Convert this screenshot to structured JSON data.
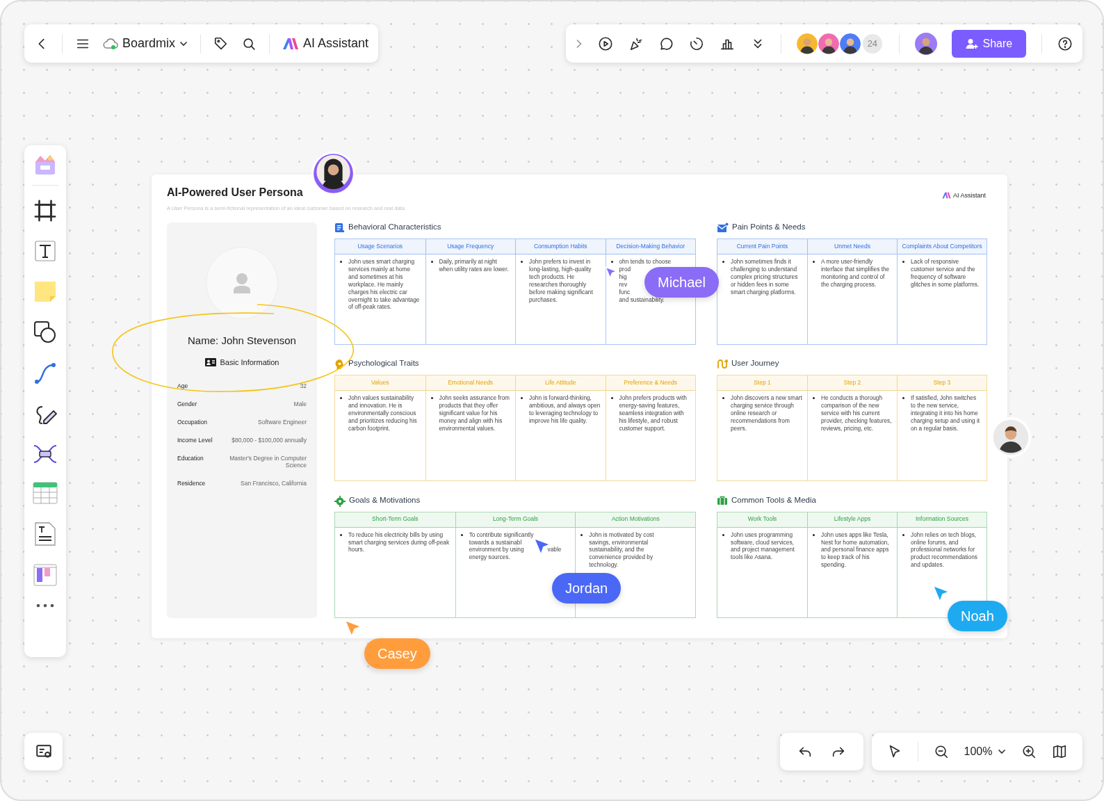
{
  "top_bar": {
    "file_name": "Boardmix",
    "ai_button": "AI Assistant",
    "collaborator_count": "24",
    "share_button": "Share"
  },
  "board": {
    "title": "AI-Powered User Persona",
    "subtitle": "A User Persona is a semi-fictional representation of an ideal customer based on research and real data.",
    "brand": "AI Assistant",
    "profile": {
      "name": "Name: John Stevenson",
      "section_title": "Basic Information",
      "fields": [
        {
          "label": "Age",
          "value": "32"
        },
        {
          "label": "Gender",
          "value": "Male"
        },
        {
          "label": "Occupation",
          "value": "Software Engineer"
        },
        {
          "label": "Income Level",
          "value": "$80,000 - $100,000 annually"
        },
        {
          "label": "Education",
          "value": "Master's Degree in Computer Science"
        },
        {
          "label": "Residence",
          "value": "San Francisco, California"
        }
      ]
    },
    "sections": [
      {
        "kind": "document",
        "title": "Behavioral Characteristics",
        "color": "#2f6fe4",
        "columns": [
          {
            "header": "Usage Scenarios",
            "text": "John uses smart charging services mainly at home and sometimes at his workplace. He mainly charges his electric car overnight to take advantage of off-peak rates."
          },
          {
            "header": "Usage Frequency",
            "text": "Daily, primarily at night when utility rates are lower."
          },
          {
            "header": "Consumption Habits",
            "text": "John prefers to invest in long-lasting, high-quality tech products. He researches thoroughly before making significant purchases."
          },
          {
            "header": "Decision-Making Behavior",
            "lines": [
              [
                "ohn tends to choose"
              ],
              [
                "prod"
              ],
              [
                "hig"
              ],
              [
                "rev"
              ],
              [
                "func"
              ],
              [
                "and sustainability."
              ]
            ]
          }
        ]
      },
      {
        "kind": "mail",
        "title": "Pain Points & Needs",
        "color": "#2f6fe4",
        "columns": [
          {
            "header": "Current Pain Points",
            "text": "John sometimes finds it challenging to understand complex pricing structures or hidden fees in some smart charging platforms."
          },
          {
            "header": "Unmet Needs",
            "text": "A more user-friendly interface that simplifies the monitoring and control of the charging process."
          },
          {
            "header": "Complaints About Competitors",
            "text": "Lack of responsive customer service and the frequency of software glitches in some platforms."
          }
        ]
      },
      {
        "kind": "bulb",
        "title": "Psychological Traits",
        "color": "#e2a300",
        "columns": [
          {
            "header": "Values",
            "text": "John values sustainability and innovation. He is environmentally conscious and prioritizes reducing his carbon footprint."
          },
          {
            "header": "Emotional Needs",
            "text": "John seeks assurance from products that they offer significant value for his money and align with his environmental values."
          },
          {
            "header": "Life Attitude",
            "text": "John is forward-thinking, ambitious, and always open to leveraging technology to improve his life quality."
          },
          {
            "header": "Preference & Needs",
            "text": "John prefers products with energy-saving features, seamless integration with his lifestyle, and robust customer support."
          }
        ]
      },
      {
        "kind": "journey",
        "title": "User Journey",
        "color": "#e2a300",
        "columns": [
          {
            "header": "Step 1",
            "text": "John discovers a new smart charging service through online research or recommendations from peers."
          },
          {
            "header": "Step 2",
            "text": "He conducts a thorough comparison of the new service with his current provider, checking features, reviews, pricing, etc."
          },
          {
            "header": "Step 3",
            "text": "If satisfied, John switches to the new service, integrating it into his home charging setup and using it on a regular basis."
          }
        ]
      },
      {
        "kind": "target",
        "title": "Goals & Motivations",
        "color": "#2ea043",
        "columns": [
          {
            "header": "Short-Term Goals",
            "text": "To reduce his electricity bills by using smart charging services during off-peak hours."
          },
          {
            "header": "Long-Term Goals",
            "lines": [
              [
                "To contribute significantly"
              ],
              [
                "towards a sustainabl"
              ],
              [
                "environment by using",
                "vable"
              ],
              [
                "energy sources."
              ]
            ]
          },
          {
            "header": "Action Motivations",
            "lines": [
              [
                "John is motivated by cost"
              ],
              [
                "savings, environmental"
              ],
              [
                "sustainability, and the"
              ],
              [
                "convenience provided by"
              ],
              [
                "technology."
              ]
            ]
          }
        ]
      },
      {
        "kind": "briefcase",
        "title": "Common Tools & Media",
        "color": "#2ea043",
        "columns": [
          {
            "header": "Work Tools",
            "text": "John uses programming software, cloud services, and project management tools like Asana."
          },
          {
            "header": "Lifestyle Apps",
            "text": "John uses apps like Tesla, Nest for home automation, and personal finance apps to keep track of his spending."
          },
          {
            "header": "Information Sources",
            "text": "John relies on tech blogs, online forums, and professional networks for product recommendations and updates."
          }
        ]
      }
    ]
  },
  "cursors": [
    {
      "name": "Michael",
      "color": "#8b6cf6"
    },
    {
      "name": "Jordan",
      "color": "#4a68f5"
    },
    {
      "name": "Noah",
      "color": "#1eaaf1"
    },
    {
      "name": "Casey",
      "color": "#ff9d3d"
    }
  ],
  "zoom_controls": {
    "level": "100%"
  }
}
